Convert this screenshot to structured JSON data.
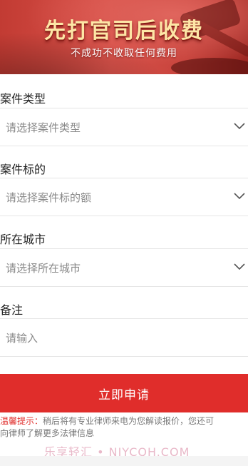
{
  "banner": {
    "title": "先打官司后收费",
    "subtitle": "不成功不收取任何费用"
  },
  "fields": {
    "case_type": {
      "label": "案件类型",
      "placeholder": "请选择案件类型"
    },
    "case_amount": {
      "label": "案件标的",
      "placeholder": "请选择案件标的额"
    },
    "city": {
      "label": "所在城市",
      "placeholder": "请选择所在城市"
    },
    "note": {
      "label": "备注",
      "placeholder": "请输入"
    }
  },
  "submit_label": "立即申请",
  "notice": {
    "prefix": "温馨提示：",
    "line1": "稍后将有专业律师来电为您解读报价，您还可",
    "line2": "向律师了解更多法律信息"
  },
  "watermark": "乐享轻汇 • NJYCQH.COM",
  "colors": {
    "accent": "#e02d2b",
    "banner_text": "#fde6a6"
  },
  "icons": {
    "select": "chevron-down-icon",
    "banner": "gavel-icon"
  }
}
